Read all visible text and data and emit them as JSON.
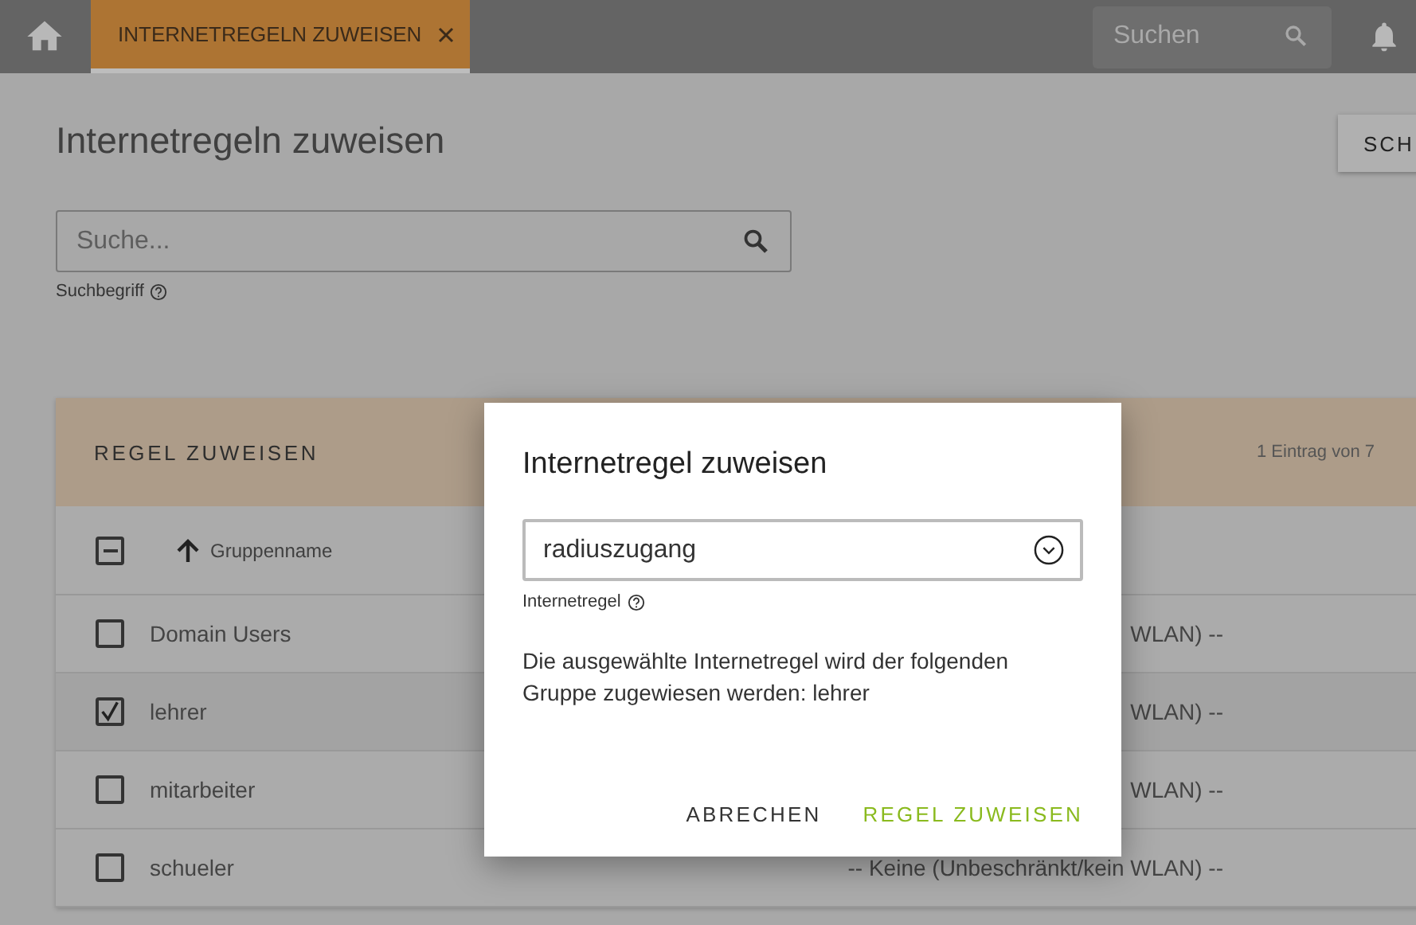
{
  "topbar": {
    "tab": {
      "label": "INTERNETREGELN ZUWEISEN",
      "selected": true
    },
    "search": {
      "placeholder": "Suchen"
    }
  },
  "page": {
    "title": "Internetregeln zuweisen",
    "action_button": "SCH",
    "search": {
      "placeholder": "Suche...",
      "label": "Suchbegriff"
    }
  },
  "card": {
    "title": "REGEL ZUWEISEN",
    "count": "1 Eintrag von 7",
    "select_all": {
      "indeterminate": true
    },
    "column": {
      "label": "Gruppenname",
      "sort_ascending": true
    },
    "rows": [
      {
        "name": "Domain Users",
        "checked": false,
        "rule": "WLAN) --"
      },
      {
        "name": "lehrer",
        "checked": true,
        "rule": "WLAN) --"
      },
      {
        "name": "mitarbeiter",
        "checked": false,
        "rule": "WLAN) --"
      },
      {
        "name": "schueler",
        "checked": false,
        "rule": "-- Keine (Unbeschränkt/kein WLAN) --"
      }
    ]
  },
  "dialog": {
    "title": "Internetregel zuweisen",
    "select": {
      "value": "radiuszugang",
      "label": "Internetregel"
    },
    "message": "Die ausgewählte Internetregel wird der folgenden Gruppe zugewiesen werden: lehrer",
    "buttons": [
      {
        "label": "ABRECHEN",
        "kind": "secondary"
      },
      {
        "label": "REGEL ZUWEISEN",
        "kind": "primary"
      }
    ]
  }
}
